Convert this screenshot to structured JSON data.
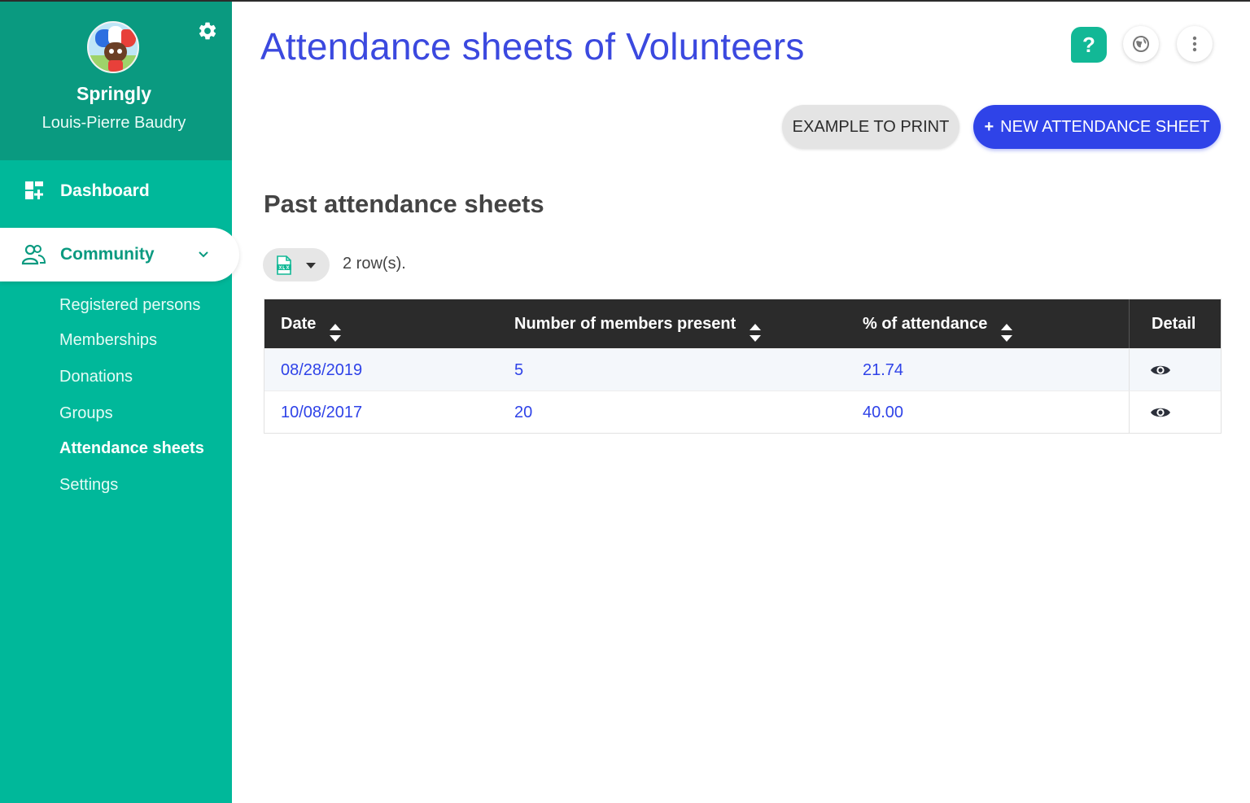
{
  "colors": {
    "sidebar": "#00b89a",
    "sidebar_header": "#0a9a80",
    "accent_blue": "#2f43e8",
    "title_blue": "#3b49df",
    "table_header": "#2b2b2b",
    "help_green": "#12b896"
  },
  "sidebar": {
    "brand": "Springly",
    "user": "Louis-Pierre Baudry",
    "settings_icon": "gear-icon",
    "nav": {
      "dashboard": {
        "label": "Dashboard",
        "icon": "dashboard-icon"
      },
      "community": {
        "label": "Community",
        "icon": "people-icon",
        "expanded": true,
        "items": [
          {
            "label": "Registered persons"
          },
          {
            "label": "Memberships"
          },
          {
            "label": "Donations"
          },
          {
            "label": "Groups"
          },
          {
            "label": "Attendance sheets",
            "active": true
          },
          {
            "label": "Settings"
          }
        ]
      }
    }
  },
  "header": {
    "title": "Attendance sheets of Volunteers",
    "help_label": "?",
    "icons": [
      "help-icon",
      "globe-icon",
      "more-vertical-icon"
    ]
  },
  "actions": {
    "example_label": "EXAMPLE TO PRINT",
    "new_plus": "+",
    "new_label": "NEW ATTENDANCE SHEET"
  },
  "section": {
    "title": "Past attendance sheets",
    "export_icon": "xlsx-file-icon",
    "row_count": "2 row(s)."
  },
  "table": {
    "columns": [
      "Date",
      "Number of members present",
      "% of attendance",
      "Detail"
    ],
    "rows": [
      {
        "date": "08/28/2019",
        "present": "5",
        "attendance": "21.74"
      },
      {
        "date": "10/08/2017",
        "present": "20",
        "attendance": "40.00"
      }
    ]
  }
}
